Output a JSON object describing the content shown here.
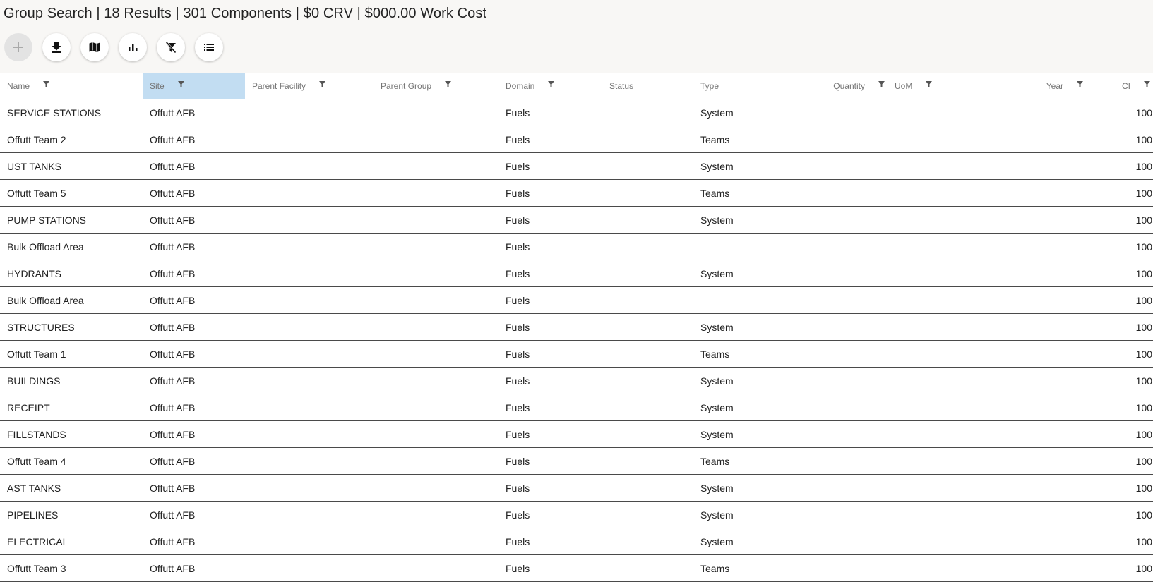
{
  "header": {
    "title": "Group Search | 18 Results | 301 Components | $0 CRV | $000.00  Work Cost"
  },
  "toolbar": {
    "buttons": [
      {
        "name": "add-button",
        "icon": "plus-icon",
        "disabled": true
      },
      {
        "name": "download-button",
        "icon": "download-icon"
      },
      {
        "name": "map-button",
        "icon": "map-icon"
      },
      {
        "name": "chart-button",
        "icon": "bar-chart-icon"
      },
      {
        "name": "clear-filters-button",
        "icon": "filter-off-icon"
      },
      {
        "name": "list-button",
        "icon": "list-icon"
      }
    ]
  },
  "columns": [
    {
      "key": "name",
      "label": "Name",
      "filter": true
    },
    {
      "key": "site",
      "label": "Site",
      "filter": true,
      "active": true
    },
    {
      "key": "parent_facility",
      "label": "Parent Facility",
      "filter": true
    },
    {
      "key": "parent_group",
      "label": "Parent Group",
      "filter": true
    },
    {
      "key": "domain",
      "label": "Domain",
      "filter": true
    },
    {
      "key": "status",
      "label": "Status",
      "filter": false
    },
    {
      "key": "type",
      "label": "Type",
      "filter": false
    },
    {
      "key": "quantity",
      "label": "Quantity",
      "filter": true
    },
    {
      "key": "uom",
      "label": "UoM",
      "filter": true
    },
    {
      "key": "year",
      "label": "Year",
      "filter": true
    },
    {
      "key": "ci",
      "label": "CI",
      "filter": true
    }
  ],
  "rows": [
    {
      "name": "SERVICE STATIONS",
      "site": "Offutt AFB",
      "parent_facility": "",
      "parent_group": "",
      "domain": "Fuels",
      "status": "",
      "type": "System",
      "quantity": "",
      "uom": "",
      "year": "",
      "ci": "100"
    },
    {
      "name": "Offutt Team 2",
      "site": "Offutt AFB",
      "parent_facility": "",
      "parent_group": "",
      "domain": "Fuels",
      "status": "",
      "type": "Teams",
      "quantity": "",
      "uom": "",
      "year": "",
      "ci": "100"
    },
    {
      "name": "UST TANKS",
      "site": "Offutt AFB",
      "parent_facility": "",
      "parent_group": "",
      "domain": "Fuels",
      "status": "",
      "type": "System",
      "quantity": "",
      "uom": "",
      "year": "",
      "ci": "100"
    },
    {
      "name": "Offutt Team 5",
      "site": "Offutt AFB",
      "parent_facility": "",
      "parent_group": "",
      "domain": "Fuels",
      "status": "",
      "type": "Teams",
      "quantity": "",
      "uom": "",
      "year": "",
      "ci": "100"
    },
    {
      "name": "PUMP STATIONS",
      "site": "Offutt AFB",
      "parent_facility": "",
      "parent_group": "",
      "domain": "Fuels",
      "status": "",
      "type": "System",
      "quantity": "",
      "uom": "",
      "year": "",
      "ci": "100"
    },
    {
      "name": "Bulk Offload Area",
      "site": "Offutt AFB",
      "parent_facility": "",
      "parent_group": "",
      "domain": "Fuels",
      "status": "",
      "type": "",
      "quantity": "",
      "uom": "",
      "year": "",
      "ci": "100"
    },
    {
      "name": "HYDRANTS",
      "site": "Offutt AFB",
      "parent_facility": "",
      "parent_group": "",
      "domain": "Fuels",
      "status": "",
      "type": "System",
      "quantity": "",
      "uom": "",
      "year": "",
      "ci": "100"
    },
    {
      "name": "Bulk Offload Area",
      "site": "Offutt AFB",
      "parent_facility": "",
      "parent_group": "",
      "domain": "Fuels",
      "status": "",
      "type": "",
      "quantity": "",
      "uom": "",
      "year": "",
      "ci": "100"
    },
    {
      "name": "STRUCTURES",
      "site": "Offutt AFB",
      "parent_facility": "",
      "parent_group": "",
      "domain": "Fuels",
      "status": "",
      "type": "System",
      "quantity": "",
      "uom": "",
      "year": "",
      "ci": "100"
    },
    {
      "name": "Offutt Team 1",
      "site": "Offutt AFB",
      "parent_facility": "",
      "parent_group": "",
      "domain": "Fuels",
      "status": "",
      "type": "Teams",
      "quantity": "",
      "uom": "",
      "year": "",
      "ci": "100"
    },
    {
      "name": "BUILDINGS",
      "site": "Offutt AFB",
      "parent_facility": "",
      "parent_group": "",
      "domain": "Fuels",
      "status": "",
      "type": "System",
      "quantity": "",
      "uom": "",
      "year": "",
      "ci": "100"
    },
    {
      "name": "RECEIPT",
      "site": "Offutt AFB",
      "parent_facility": "",
      "parent_group": "",
      "domain": "Fuels",
      "status": "",
      "type": "System",
      "quantity": "",
      "uom": "",
      "year": "",
      "ci": "100"
    },
    {
      "name": "FILLSTANDS",
      "site": "Offutt AFB",
      "parent_facility": "",
      "parent_group": "",
      "domain": "Fuels",
      "status": "",
      "type": "System",
      "quantity": "",
      "uom": "",
      "year": "",
      "ci": "100"
    },
    {
      "name": "Offutt Team 4",
      "site": "Offutt AFB",
      "parent_facility": "",
      "parent_group": "",
      "domain": "Fuels",
      "status": "",
      "type": "Teams",
      "quantity": "",
      "uom": "",
      "year": "",
      "ci": "100"
    },
    {
      "name": "AST TANKS",
      "site": "Offutt AFB",
      "parent_facility": "",
      "parent_group": "",
      "domain": "Fuels",
      "status": "",
      "type": "System",
      "quantity": "",
      "uom": "",
      "year": "",
      "ci": "100"
    },
    {
      "name": "PIPELINES",
      "site": "Offutt AFB",
      "parent_facility": "",
      "parent_group": "",
      "domain": "Fuels",
      "status": "",
      "type": "System",
      "quantity": "",
      "uom": "",
      "year": "",
      "ci": "100"
    },
    {
      "name": "ELECTRICAL",
      "site": "Offutt AFB",
      "parent_facility": "",
      "parent_group": "",
      "domain": "Fuels",
      "status": "",
      "type": "System",
      "quantity": "",
      "uom": "",
      "year": "",
      "ci": "100"
    },
    {
      "name": "Offutt Team 3",
      "site": "Offutt AFB",
      "parent_facility": "",
      "parent_group": "",
      "domain": "Fuels",
      "status": "",
      "type": "Teams",
      "quantity": "",
      "uom": "",
      "year": "",
      "ci": "100"
    }
  ]
}
